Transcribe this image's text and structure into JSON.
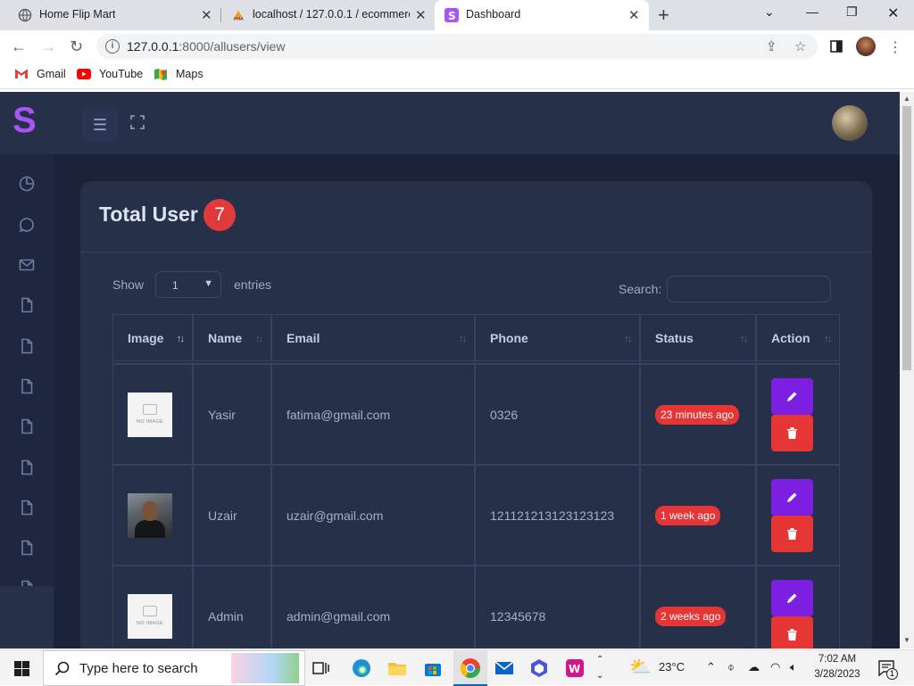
{
  "browser": {
    "tabs": [
      {
        "title": "Home Flip Mart",
        "active": false
      },
      {
        "title": "localhost / 127.0.0.1 / ecommerc",
        "active": false
      },
      {
        "title": "Dashboard",
        "active": true
      }
    ],
    "url_host": "127.0.0.1",
    "url_path": ":8000/allusers/view",
    "bookmarks": [
      "Gmail",
      "YouTube",
      "Maps"
    ]
  },
  "app": {
    "logo_letter": "S",
    "card": {
      "title": "Total User",
      "count": "7",
      "show_label": "Show",
      "entries_value": "1",
      "entries_label": "entries",
      "search_label": "Search:"
    },
    "table": {
      "headers": [
        "Image",
        "Name",
        "Email",
        "Phone",
        "Status",
        "Action"
      ],
      "rows": [
        {
          "image": "NO IMAGE",
          "name": "Yasir",
          "email": "fatima@gmail.com",
          "phone": "0326",
          "status": "23 minutes ago"
        },
        {
          "image": "photo",
          "name": "Uzair",
          "email": "uzair@gmail.com",
          "phone": "121121213123123123",
          "status": "1 week ago"
        },
        {
          "image": "NO IMAGE",
          "name": "Admin",
          "email": "admin@gmail.com",
          "phone": "12345678",
          "status": "2 weeks ago"
        }
      ]
    }
  },
  "taskbar": {
    "search_placeholder": "Type here to search",
    "temperature": "23°C",
    "time": "7:02 AM",
    "date": "3/28/2023",
    "notification_count": "1"
  },
  "colors": {
    "app_bg": "#1c2237",
    "card_bg": "#273049",
    "accent_purple": "#7c1fe0",
    "danger_red": "#e53535"
  }
}
